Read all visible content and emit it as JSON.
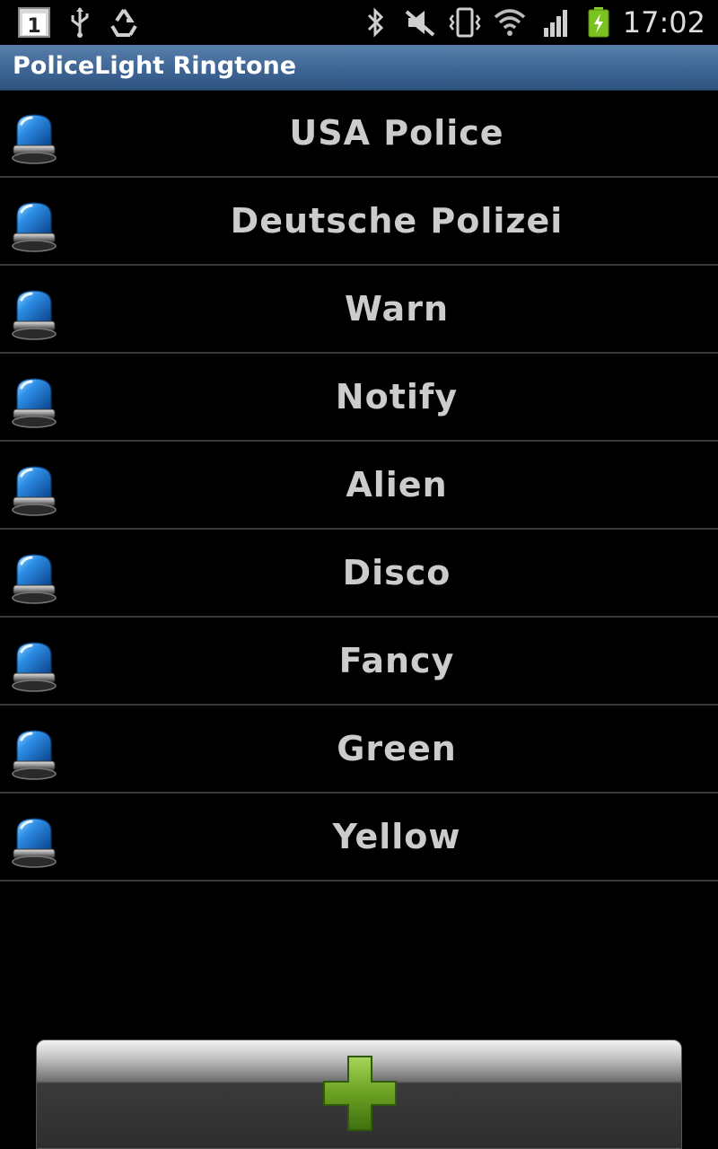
{
  "status_bar": {
    "notification_badge": "1",
    "time": "17:02",
    "icons": [
      "notification-count-icon",
      "usb-icon",
      "recycle-icon",
      "bluetooth-icon",
      "mute-icon",
      "vibrate-icon",
      "wifi-icon",
      "signal-icon",
      "battery-charging-icon"
    ]
  },
  "app": {
    "title": "PoliceLight Ringtone"
  },
  "ringtones": [
    {
      "label": "USA Police"
    },
    {
      "label": "Deutsche Polizei"
    },
    {
      "label": "Warn"
    },
    {
      "label": "Notify"
    },
    {
      "label": "Alien"
    },
    {
      "label": "Disco"
    },
    {
      "label": "Fancy"
    },
    {
      "label": "Green"
    },
    {
      "label": "Yellow"
    }
  ],
  "add_button": {
    "icon": "plus-icon",
    "color": "#6aa022"
  },
  "colors": {
    "title_bar": "#3e6594",
    "siren_blue": "#1f7fd6",
    "background": "#000000"
  }
}
